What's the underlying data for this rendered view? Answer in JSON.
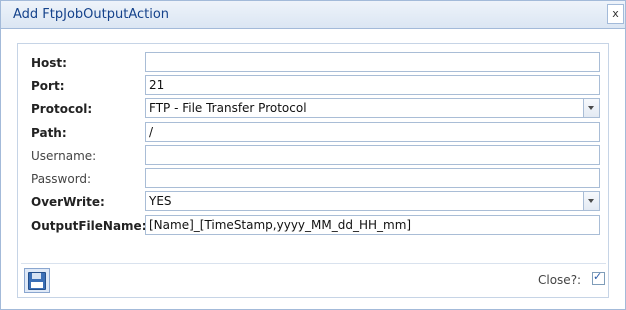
{
  "window": {
    "title": "Add FtpJobOutputAction",
    "close_glyph": "x"
  },
  "form": {
    "host": {
      "label": "Host:",
      "value": ""
    },
    "port": {
      "label": "Port:",
      "value": "21"
    },
    "protocol": {
      "label": "Protocol:",
      "value": "FTP - File Transfer Protocol"
    },
    "path": {
      "label": "Path:",
      "value": "/"
    },
    "username": {
      "label": "Username:",
      "value": ""
    },
    "password": {
      "label": "Password:",
      "value": ""
    },
    "overwrite": {
      "label": "OverWrite:",
      "value": "YES"
    },
    "outputfilename": {
      "label": "OutputFileName:",
      "value": "[Name]_[TimeStamp,yyyy_MM_dd_HH_mm]"
    }
  },
  "footer": {
    "close_label": "Close?:",
    "close_checked": true,
    "check_glyph": "✓"
  },
  "icons": {
    "save": "floppy-disk-icon",
    "dropdown": "chevron-down-icon"
  }
}
